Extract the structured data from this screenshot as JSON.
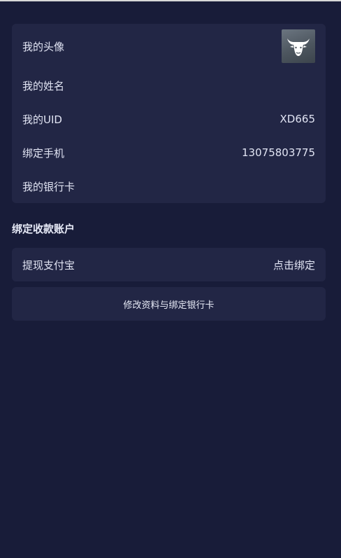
{
  "profile": {
    "avatar_label": "我的头像",
    "name_label": "我的姓名",
    "name_value": "",
    "uid_label": "我的UID",
    "uid_value": "XD665",
    "phone_label": "绑定手机",
    "phone_value": "13075803775",
    "bank_label": "我的银行卡",
    "bank_value": ""
  },
  "receiving": {
    "section_title": "绑定收款账户",
    "alipay_label": "提现支付宝",
    "alipay_action": "点击绑定"
  },
  "actions": {
    "edit_button_label": "修改资料与绑定银行卡"
  },
  "icons": {
    "avatar": "bull-head-icon"
  },
  "colors": {
    "background": "#181c39",
    "card": "#222645",
    "text": "#e1e4f3"
  }
}
